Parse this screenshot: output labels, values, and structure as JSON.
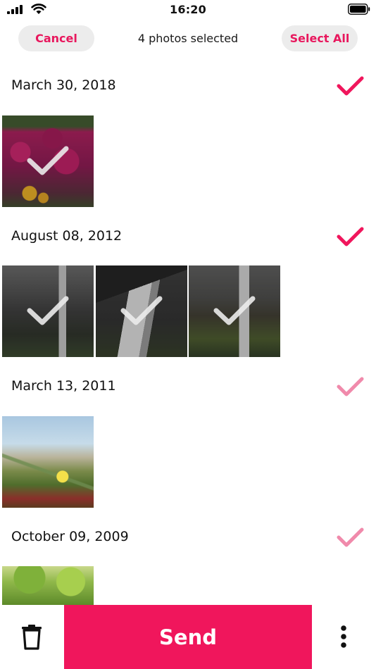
{
  "status_bar": {
    "time": "16:20",
    "icons": [
      "cellular-signal-icon",
      "wifi-icon",
      "battery-icon"
    ]
  },
  "nav": {
    "cancel_label": "Cancel",
    "title": "4 photos selected",
    "select_all_label": "Select All"
  },
  "sections": [
    {
      "date": "March 30, 2018",
      "selected": true,
      "photo_count": 1,
      "photos_selected": [
        true
      ]
    },
    {
      "date": "August 08, 2012",
      "selected": true,
      "photo_count": 3,
      "photos_selected": [
        true,
        true,
        true
      ]
    },
    {
      "date": "March 13, 2011",
      "selected": false,
      "photo_count": 1,
      "photos_selected": [
        false
      ]
    },
    {
      "date": "October 09, 2009",
      "selected": false,
      "photo_count": 1,
      "photos_selected": [
        false
      ]
    }
  ],
  "bottom_bar": {
    "send_label": "Send",
    "icons": [
      "trash-icon",
      "more-vertical-icon"
    ]
  },
  "colors": {
    "accent": "#f0165c",
    "accent_light": "#f08aab",
    "pill_background": "#ececec"
  }
}
